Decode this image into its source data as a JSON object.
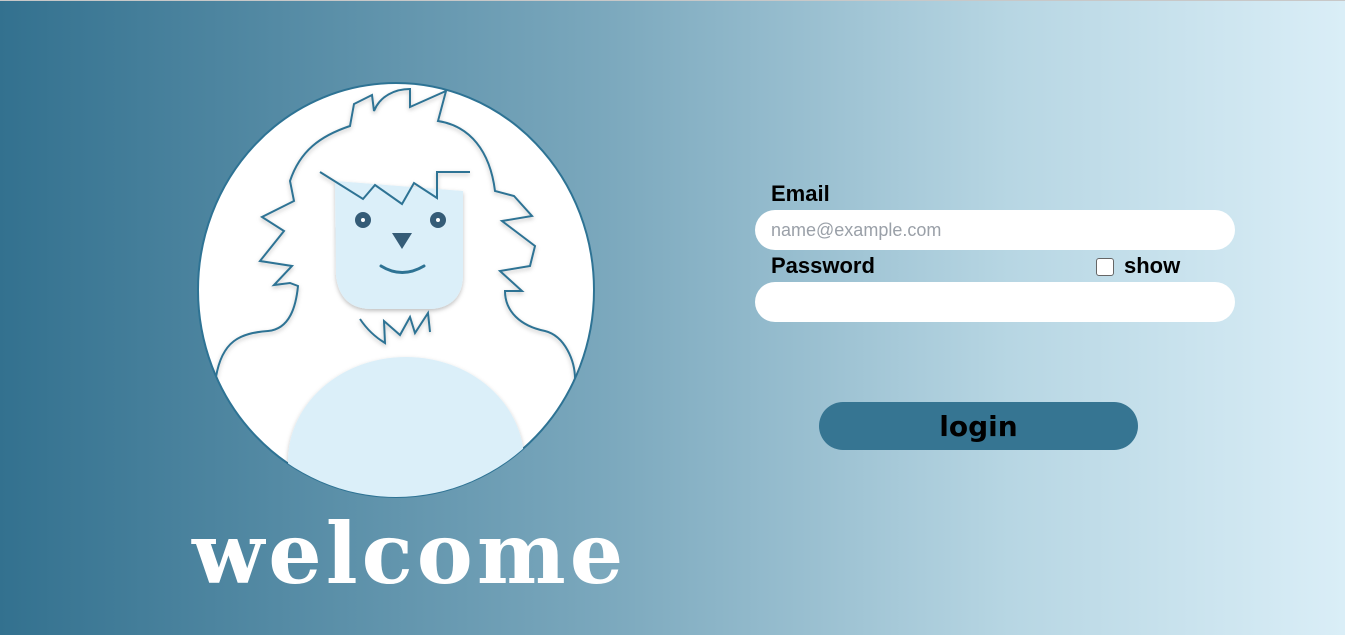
{
  "hero": {
    "welcome_text": "welcome"
  },
  "form": {
    "email_label": "Email",
    "email_placeholder": "name@example.com",
    "email_value": "",
    "password_label": "Password",
    "password_value": "",
    "show_label": "show",
    "show_checked": false,
    "login_label": "login"
  },
  "colors": {
    "accent": "#367592",
    "yeti_light": "#dbeff9",
    "outline": "#2e7394"
  }
}
